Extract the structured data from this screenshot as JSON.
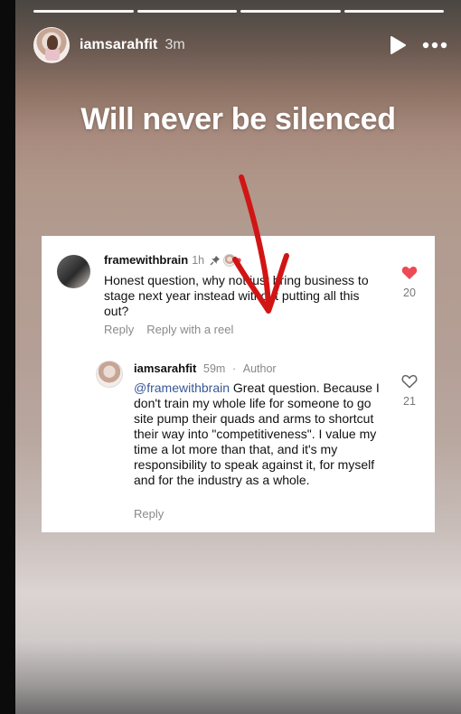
{
  "story": {
    "segments": 4,
    "username": "iamsarahfit",
    "time": "3m",
    "caption": "Will never be silenced",
    "icons": {
      "play": "play-icon",
      "more": "more-horizontal-icon"
    }
  },
  "comments": [
    {
      "username": "framewithbrain",
      "time": "1h",
      "text": "Honest question, why not just bring business to stage next year instead without putting all this out?",
      "likes": "20",
      "liked": true,
      "actions": [
        "Reply",
        "Reply with a reel"
      ],
      "pinned": true
    },
    {
      "username": "iamsarahfit",
      "time": "59m",
      "role": "Author",
      "mention": "@framewithbrain",
      "text": " Great question. Because I don't train my whole life for someone to go site pump their quads and arms to shortcut their way into \"competitiveness\". I value my time a lot more than that, and it's my responsibility to speak against it, for myself and for the industry as a whole.",
      "likes": "21",
      "liked": false,
      "actions": [
        "Reply"
      ]
    }
  ],
  "colors": {
    "heart_liked": "#ed4956",
    "arrow": "#d11515",
    "mention": "#385898"
  }
}
